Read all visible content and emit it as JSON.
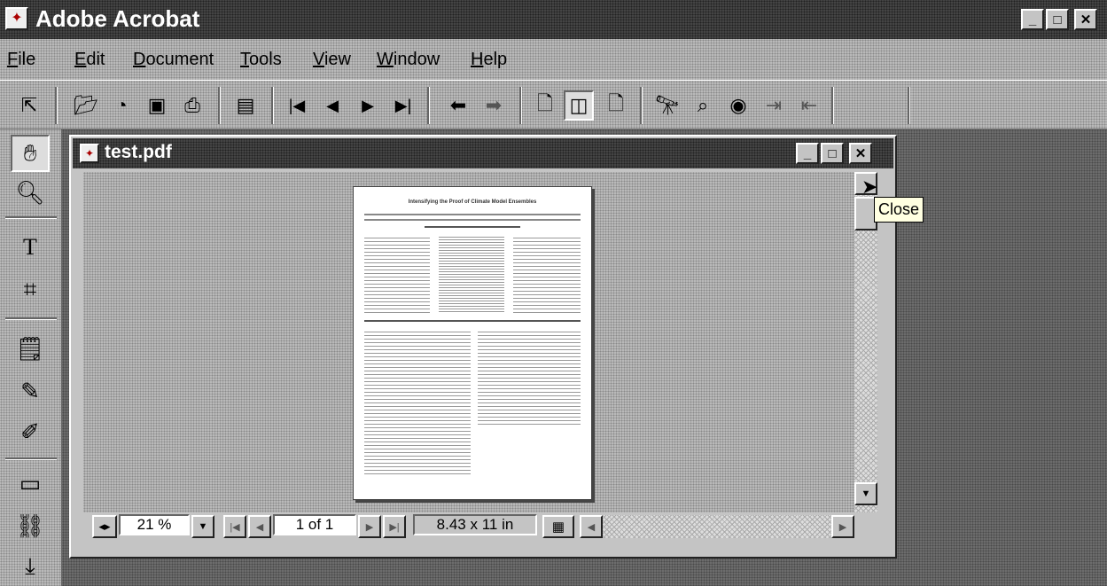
{
  "app": {
    "title": "Adobe Acrobat",
    "window_controls": {
      "minimize": "_",
      "maximize": "□",
      "close": "✕"
    }
  },
  "menu": [
    {
      "label": "File",
      "mnemonic": "F"
    },
    {
      "label": "Edit",
      "mnemonic": "E"
    },
    {
      "label": "Document",
      "mnemonic": "D"
    },
    {
      "label": "Tools",
      "mnemonic": "T"
    },
    {
      "label": "View",
      "mnemonic": "V"
    },
    {
      "label": "Window",
      "mnemonic": "W"
    },
    {
      "label": "Help",
      "mnemonic": "H"
    }
  ],
  "toolbar": {
    "icons": [
      "show-hide-navigation-icon",
      "open-icon",
      "open-web-page-icon",
      "save-icon",
      "print-icon",
      "bookmarks-icon",
      "first-page-icon",
      "previous-page-icon",
      "next-page-icon",
      "last-page-icon",
      "go-back-icon",
      "go-forward-icon",
      "actual-size-icon",
      "fit-page-icon",
      "fit-width-icon",
      "find-icon",
      "search-icon",
      "web-links-icon",
      "insert-pages-icon",
      "extract-pages-icon"
    ]
  },
  "tools": {
    "icons": [
      "hand-tool-icon",
      "zoom-tool-icon",
      "text-select-tool-icon",
      "crop-tool-icon",
      "note-tool-icon",
      "pencil-tool-icon",
      "highlight-tool-icon",
      "movie-tool-icon",
      "link-tool-icon",
      "article-tool-icon"
    ]
  },
  "document": {
    "title": "test.pdf",
    "tooltip": "Close",
    "page_title": "Intensifying the Proof of Climate Model Ensembles"
  },
  "statusbar": {
    "zoom": "21 %",
    "page": "1 of 1",
    "page_size": "8.43 x 11 in"
  },
  "colors": {
    "face": "#c4c4c4",
    "workspace": "#6c6c6c",
    "document_area": "#b9b9b9",
    "title_bar": "#444444"
  }
}
